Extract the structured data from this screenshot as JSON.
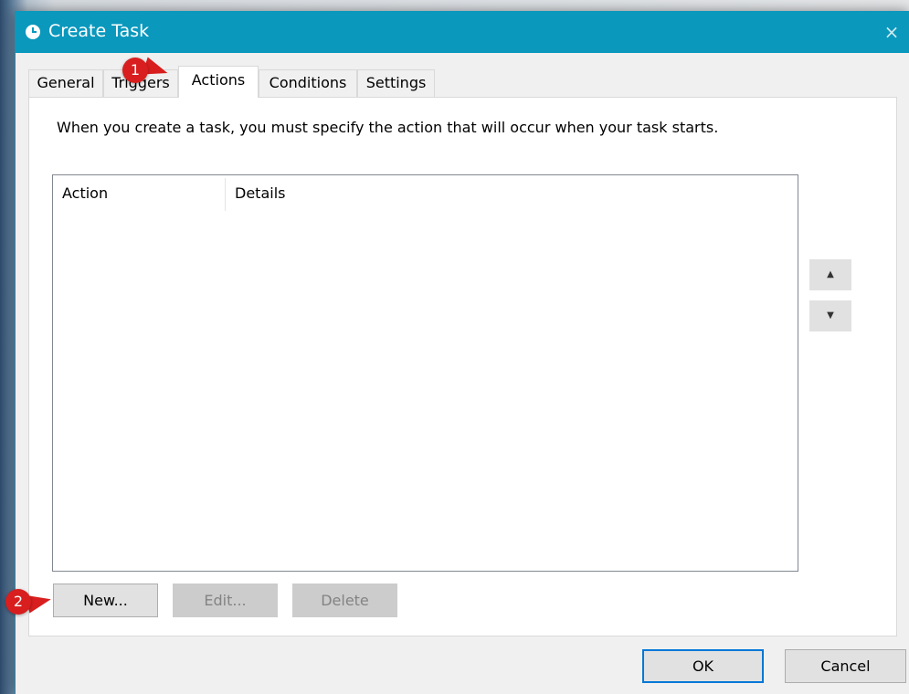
{
  "window": {
    "title": "Create Task",
    "close_glyph": "×",
    "icon": "clock-icon"
  },
  "tabs": [
    {
      "label": "General",
      "active": false
    },
    {
      "label": "Triggers",
      "active": false
    },
    {
      "label": "Actions",
      "active": true
    },
    {
      "label": "Conditions",
      "active": false
    },
    {
      "label": "Settings",
      "active": false
    }
  ],
  "actions_panel": {
    "instructions": "When you create a task, you must specify the action that will occur when your task starts.",
    "columns": [
      "Action",
      "Details"
    ],
    "rows": [],
    "move_up_glyph": "▲",
    "move_down_glyph": "▼",
    "new_label": "New...",
    "edit_label": "Edit...",
    "delete_label": "Delete"
  },
  "footer": {
    "ok_label": "OK",
    "cancel_label": "Cancel"
  },
  "annotations": {
    "step1": "1",
    "step2": "2",
    "color": "#d81e1e"
  },
  "colors": {
    "titlebar": "#0a98bd",
    "focus_border": "#0078d7"
  }
}
